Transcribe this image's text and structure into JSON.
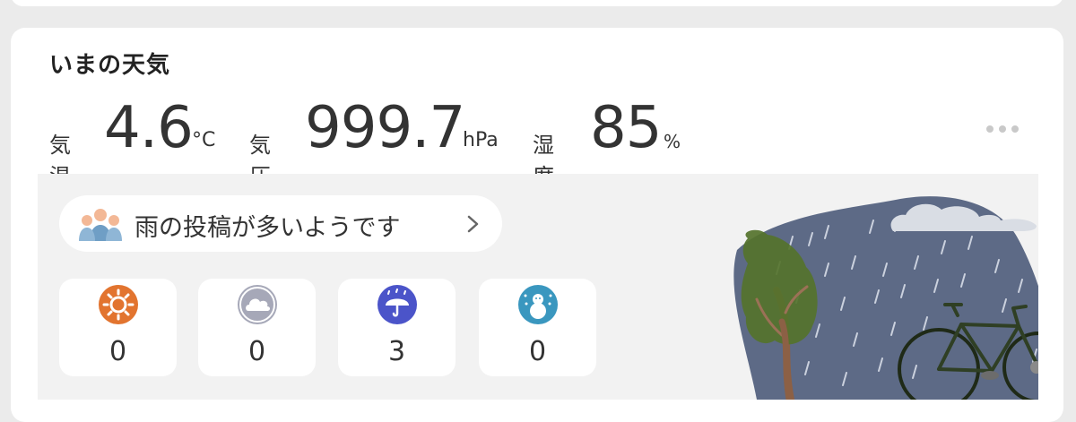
{
  "card": {
    "title": "いまの天気"
  },
  "stats": {
    "temp_label": "気温",
    "temp_value": "4.6",
    "temp_unit": "°C",
    "pressure_label": "気圧",
    "pressure_value": "999.7",
    "pressure_unit": "hPa",
    "humidity_label": "湿度",
    "humidity_value": "85",
    "humidity_unit": "%"
  },
  "report": {
    "text": "雨の投稿が多いようです",
    "icon": "people-icon"
  },
  "tiles": [
    {
      "icon": "sun-icon",
      "count": "0",
      "color": "#e2742f"
    },
    {
      "icon": "cloud-icon",
      "count": "0",
      "color": "#a6a8b8"
    },
    {
      "icon": "umbrella-icon",
      "count": "3",
      "color": "#4b54c9"
    },
    {
      "icon": "snowman-icon",
      "count": "0",
      "color": "#3a97bf"
    }
  ],
  "colors": {
    "rain_bg": "#5d6a86",
    "tree": "#55732d",
    "trunk": "#8c6045",
    "bike": "#2f3f24"
  }
}
